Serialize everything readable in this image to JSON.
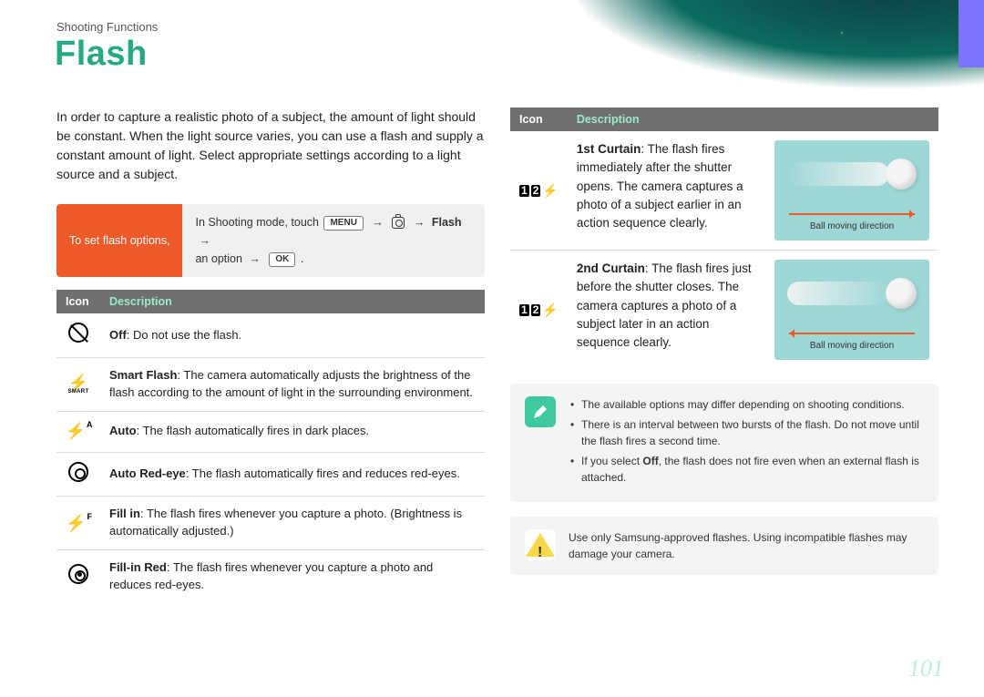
{
  "breadcrumb": "Shooting Functions",
  "title": "Flash",
  "intro": "In order to capture a realistic photo of a subject, the amount of light should be constant. When the light source varies, you can use a flash and supply a constant amount of light. Select appropriate settings according to a light source and a subject.",
  "setbox": {
    "label": "To set flash options,",
    "line1_pre": "In Shooting mode, touch ",
    "menu_key": "MENU",
    "flash_word": "Flash",
    "line2_pre": "an option ",
    "ok_key": "OK"
  },
  "table_headers": {
    "icon": "Icon",
    "desc": "Description"
  },
  "left_rows": [
    {
      "icon": "off",
      "bold": "Off",
      "rest": ": Do not use the flash."
    },
    {
      "icon": "smart",
      "bold": "Smart Flash",
      "rest": ": The camera automatically adjusts the brightness of the flash according to the amount of light in the surrounding environment."
    },
    {
      "icon": "auto",
      "bold": "Auto",
      "rest": ": The flash automatically fires in dark places."
    },
    {
      "icon": "redeye",
      "bold": "Auto Red-eye",
      "rest": ": The flash automatically fires and reduces red-eyes."
    },
    {
      "icon": "fillin",
      "bold": "Fill in",
      "rest": ": The flash fires whenever you capture a photo. (Brightness is automatically adjusted.)"
    },
    {
      "icon": "fillred",
      "bold": "Fill-in Red",
      "rest": ": The flash fires whenever you capture a photo and reduces red-eyes."
    }
  ],
  "right_rows": [
    {
      "icon": "c1",
      "bold": "1st Curtain",
      "rest": ": The flash fires immediately after the shutter opens. The camera captures a photo of a subject earlier in an action sequence clearly.",
      "caption": "Ball moving direction"
    },
    {
      "icon": "c2",
      "bold": "2nd Curtain",
      "rest": ": The flash fires just before the shutter closes. The camera captures a photo of a subject later in an action sequence clearly.",
      "caption": "Ball moving direction"
    }
  ],
  "smart_label": "SMART",
  "notes": {
    "n1": "The available options may differ depending on shooting conditions.",
    "n2": "There is an interval between two bursts of the flash. Do not move until the flash fires a second time.",
    "n3_pre": "If you select ",
    "n3_bold": "Off",
    "n3_post": ", the flash does not fire even when an external flash is attached."
  },
  "warning": "Use only Samsung-approved flashes. Using incompatible flashes may damage your camera.",
  "page_number": "101"
}
